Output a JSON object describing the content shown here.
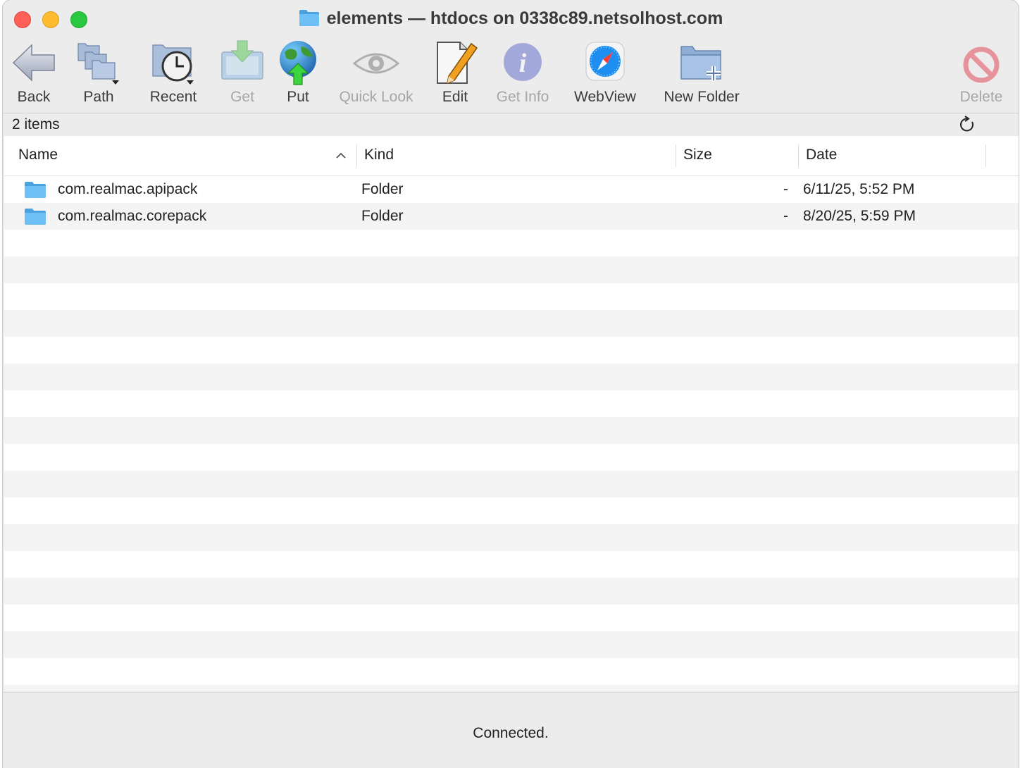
{
  "window": {
    "title": "elements — htdocs on 0338c89.netsolhost.com"
  },
  "toolbar": {
    "items": [
      {
        "id": "back",
        "label": "Back",
        "icon": "back-arrow-icon",
        "enabled": true
      },
      {
        "id": "path",
        "label": "Path",
        "icon": "stacked-folders-icon",
        "enabled": true
      },
      {
        "id": "recent",
        "label": "Recent",
        "icon": "clock-folder-icon",
        "enabled": true
      },
      {
        "id": "get",
        "label": "Get",
        "icon": "download-icon",
        "enabled": false
      },
      {
        "id": "put",
        "label": "Put",
        "icon": "globe-upload-icon",
        "enabled": true
      },
      {
        "id": "quick-look",
        "label": "Quick Look",
        "icon": "eye-icon",
        "enabled": false
      },
      {
        "id": "edit",
        "label": "Edit",
        "icon": "pencil-document-icon",
        "enabled": true
      },
      {
        "id": "get-info",
        "label": "Get Info",
        "icon": "info-icon",
        "enabled": false
      },
      {
        "id": "webview",
        "label": "WebView",
        "icon": "compass-icon",
        "enabled": true
      },
      {
        "id": "new-folder",
        "label": "New Folder",
        "icon": "new-folder-icon",
        "enabled": true
      },
      {
        "id": "delete",
        "label": "Delete",
        "icon": "prohibited-icon",
        "enabled": false
      }
    ]
  },
  "itemsbar": {
    "count_label": "2 items"
  },
  "list": {
    "columns": {
      "name": "Name",
      "kind": "Kind",
      "size": "Size",
      "date": "Date"
    },
    "rows": [
      {
        "name": "com.realmac.apipack",
        "kind": "Folder",
        "size": "-",
        "date": "6/11/25, 5:52 PM"
      },
      {
        "name": "com.realmac.corepack",
        "kind": "Folder",
        "size": "-",
        "date": "8/20/25, 5:59 PM"
      }
    ]
  },
  "status": {
    "text": "Connected."
  },
  "colors": {
    "folder": "#5bb5f0",
    "close": "#fe5f57",
    "minimize": "#febc2e",
    "zoom": "#28c840"
  }
}
